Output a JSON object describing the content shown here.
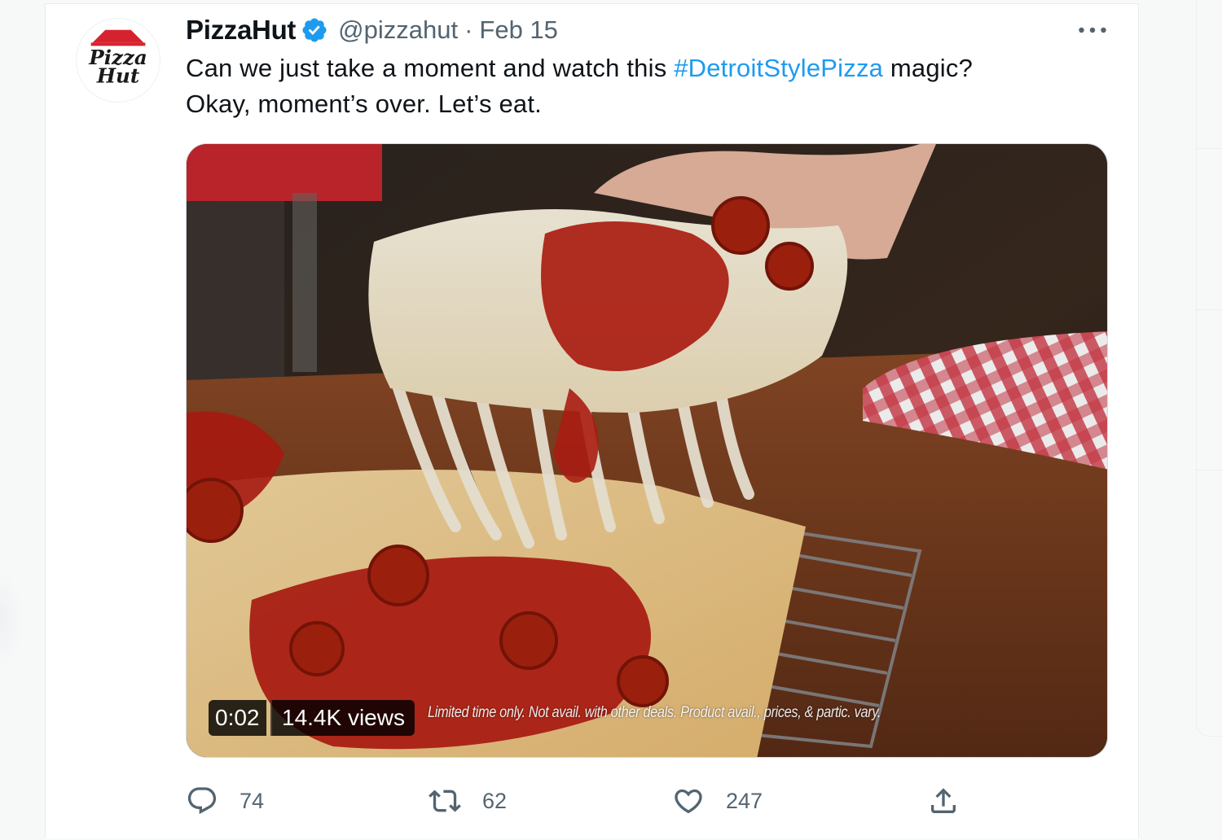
{
  "tweet": {
    "display_name": "PizzaHut",
    "handle": "@pizzahut",
    "separator": "·",
    "date": "Feb 15",
    "text_before": "Can we just take a moment and watch this ",
    "hashtag": "#DetroitStylePizza",
    "text_after": " magic?",
    "text_line2": "Okay, moment’s over. Let’s eat.",
    "avatar_logo_line1": "Pizza",
    "avatar_logo_line2": "Hut"
  },
  "media": {
    "duration": "0:02",
    "views": "14.4K views",
    "disclaimer": "Limited time only. Not avail. with other deals. Product avail., prices, & partic. vary."
  },
  "actions": {
    "replies": "74",
    "retweets": "62",
    "likes": "247"
  },
  "colors": {
    "accent": "#1d9bf0",
    "text_primary": "#0f1419",
    "text_secondary": "#536471"
  }
}
